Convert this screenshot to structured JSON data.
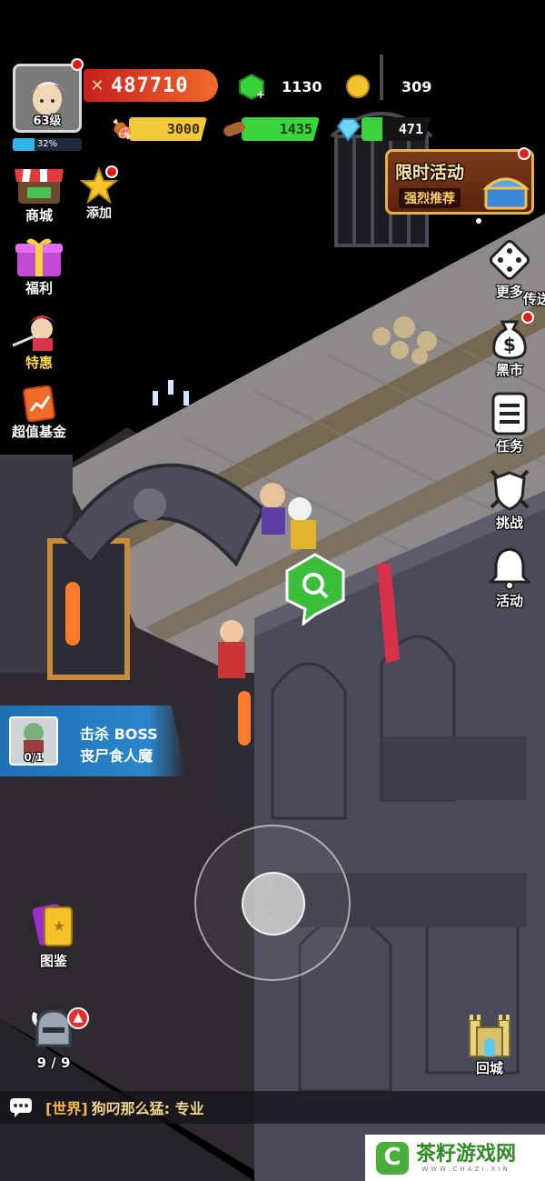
{
  "player": {
    "level": "63级",
    "exp_percent": "32%",
    "exp_fraction": 0.32,
    "power": "487710"
  },
  "resources": {
    "gems": "1130",
    "gold": "309",
    "meat": "3000",
    "wood": "1435",
    "crystal": "471"
  },
  "left_menu": {
    "shop": "商城",
    "add": "添加",
    "welfare": "福利",
    "special": "特惠",
    "fund": "超值基金"
  },
  "event_banner": {
    "title": "限时活动",
    "subtitle": "强烈推荐"
  },
  "right_menu": {
    "more": "更多",
    "teleport": "传送",
    "black_market": "黑市",
    "quest": "任务",
    "challenge": "挑战",
    "activity": "活动"
  },
  "quest_tracker": {
    "progress": "0/1",
    "line1": "击杀 BOSS",
    "line2": "丧尸食人魔"
  },
  "bottom": {
    "codex": "图鉴",
    "heroes": "9 / 9",
    "return_city": "回城"
  },
  "chat": {
    "channel": "[世界]",
    "message": "狗叼那么猛: 专业"
  },
  "watermark": {
    "name": "茶籽游戏网",
    "url": "WWW.CHAZI.XIN"
  },
  "colors": {
    "power_bar": "#e8382f",
    "meat_bar": "#f2c93a",
    "wood_bar": "#3bd43b",
    "crystal_bar": "#3bd43b",
    "exp_bar": "#2fb5e8",
    "quest_panel": "#1f6fb3"
  }
}
